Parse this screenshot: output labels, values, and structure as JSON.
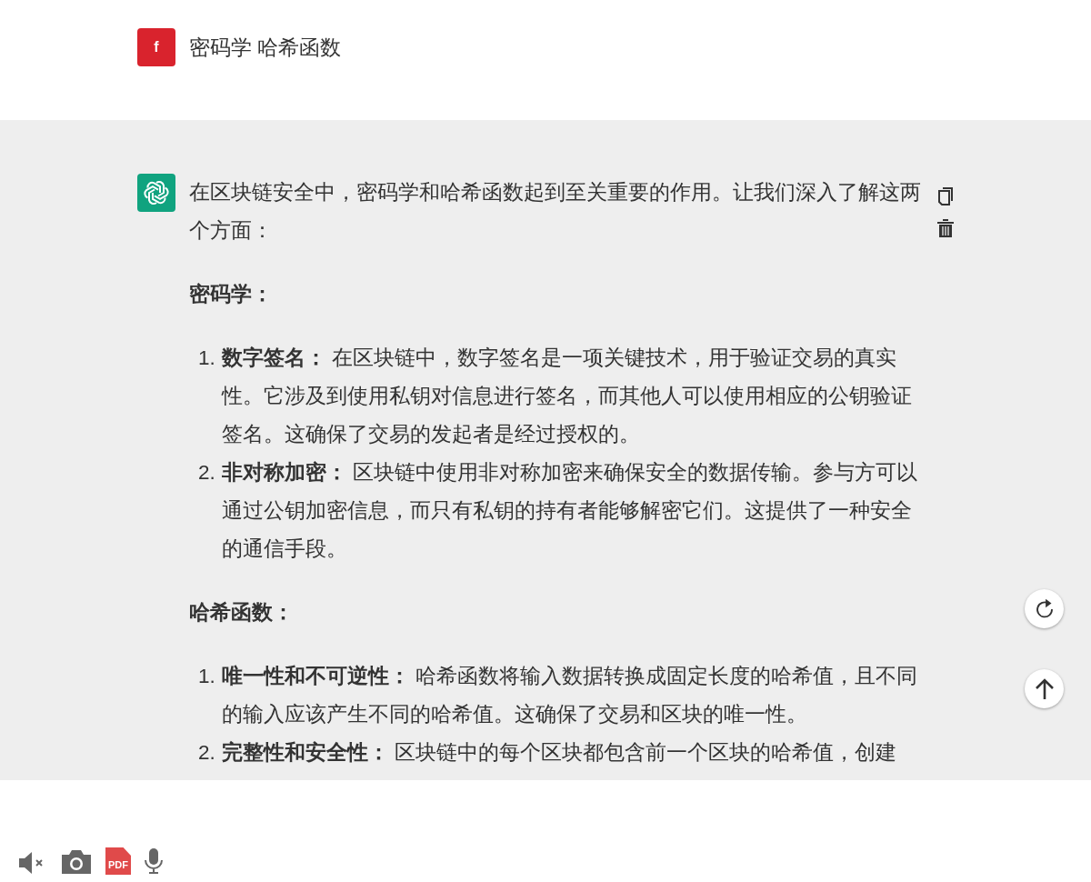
{
  "user_message": {
    "avatar_letter": "f",
    "text": "密码学 哈希函数"
  },
  "assistant_message": {
    "intro": "在区块链安全中，密码学和哈希函数起到至关重要的作用。让我们深入了解这两个方面：",
    "sections": [
      {
        "heading": "密码学：",
        "items": [
          {
            "number": "1.",
            "text": "**数字签名：** 在区块链中，数字签名是一项关键技术，用于验证交易的真实性。它涉及到使用私钥对信息进行签名，而其他人可以使用相应的公钥验证签名。这确保了交易的发起者是经过授权的。"
          },
          {
            "number": "2.",
            "text": "**非对称加密：** 区块链中使用非对称加密来确保安全的数据传输。参与方可以通过公钥加密信息，而只有私钥的持有者能够解密它们。这提供了一种安全的通信手段。"
          }
        ]
      },
      {
        "heading": "哈希函数：",
        "items": [
          {
            "number": "1.",
            "text": "**唯一性和不可逆性：** 哈希函数将输入数据转换成固定长度的哈希值，且不同的输入应该产生不同的哈希值。这确保了交易和区块的唯一性。"
          },
          {
            "number": "2.",
            "text": "**完整性和安全性：** 区块链中的每个区块都包含前一个区块的哈希值，创建"
          }
        ]
      }
    ]
  },
  "bottom_toolbar": {
    "pdf_label": "PDF",
    "muted": true
  }
}
